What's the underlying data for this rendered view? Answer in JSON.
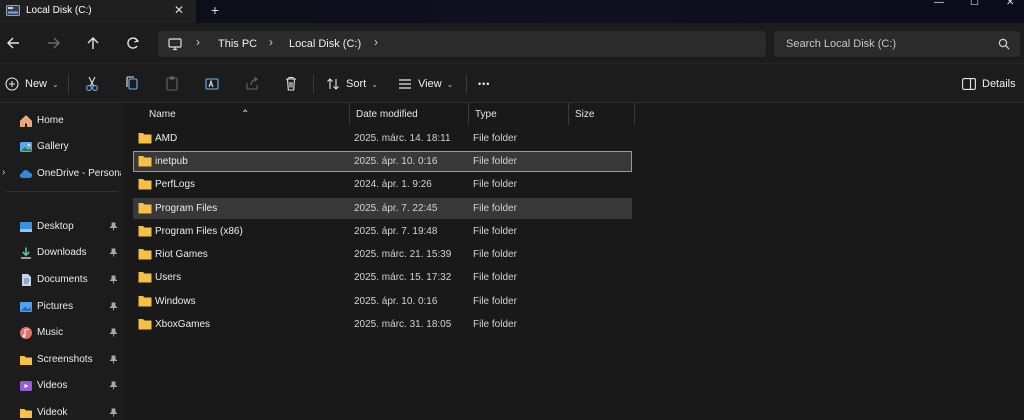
{
  "window": {
    "tab_title": "Local Disk (C:)",
    "tab_close": "✕",
    "new_tab": "+",
    "minimize": "—",
    "maximize": "☐",
    "close": "✕"
  },
  "navigation": {
    "breadcrumb": [
      "This PC",
      "Local Disk (C:)"
    ],
    "search_placeholder": "Search Local Disk (C:)"
  },
  "commands": {
    "new": "New",
    "sort": "Sort",
    "view": "View",
    "more": "•••",
    "details": "Details"
  },
  "sidebar": {
    "top": [
      {
        "label": "Home",
        "icon": "home-icon"
      },
      {
        "label": "Gallery",
        "icon": "gallery-icon"
      },
      {
        "label": "OneDrive - Persona",
        "icon": "cloud-icon"
      }
    ],
    "quick_access": [
      {
        "label": "Desktop",
        "icon": "desktop-folder-icon"
      },
      {
        "label": "Downloads",
        "icon": "downloads-icon"
      },
      {
        "label": "Documents",
        "icon": "documents-icon"
      },
      {
        "label": "Pictures",
        "icon": "pictures-icon"
      },
      {
        "label": "Music",
        "icon": "music-icon"
      },
      {
        "label": "Screenshots",
        "icon": "folder-icon"
      },
      {
        "label": "Videos",
        "icon": "videos-icon"
      },
      {
        "label": "Videok",
        "icon": "folder-icon"
      }
    ]
  },
  "columns": {
    "name": "Name",
    "date": "Date modified",
    "type": "Type",
    "size": "Size"
  },
  "files": [
    {
      "name": "AMD",
      "date": "2025. márc. 14. 18:11",
      "type": "File folder"
    },
    {
      "name": "inetpub",
      "date": "2025. ápr. 10. 0:16",
      "type": "File folder",
      "state": "focused"
    },
    {
      "name": "PerfLogs",
      "date": "2024. ápr. 1. 9:26",
      "type": "File folder"
    },
    {
      "name": "Program Files",
      "date": "2025. ápr. 7. 22:45",
      "type": "File folder",
      "state": "selected"
    },
    {
      "name": "Program Files (x86)",
      "date": "2025. ápr. 7. 19:48",
      "type": "File folder"
    },
    {
      "name": "Riot Games",
      "date": "2025. márc. 21. 15:39",
      "type": "File folder"
    },
    {
      "name": "Users",
      "date": "2025. márc. 15. 17:32",
      "type": "File folder"
    },
    {
      "name": "Windows",
      "date": "2025. ápr. 10. 0:16",
      "type": "File folder"
    },
    {
      "name": "XboxGames",
      "date": "2025. márc. 31. 18:05",
      "type": "File folder"
    }
  ],
  "colors": {
    "folder": "#f5c043",
    "accent": "#4aa3f0",
    "selection": "#383838"
  }
}
